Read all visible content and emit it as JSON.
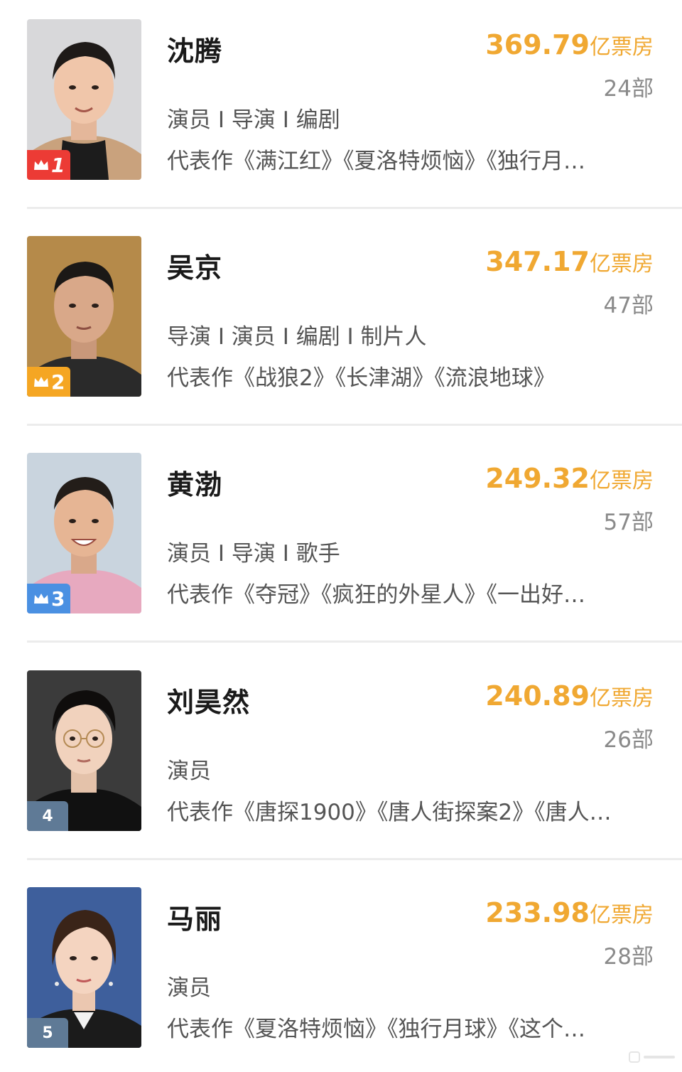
{
  "ranking": [
    {
      "rank": "1",
      "name": "沈腾",
      "box_office": "369.79",
      "box_office_unit": "亿票房",
      "film_count": "24部",
      "roles": "演员 I 导演 I 编剧",
      "works": "代表作《满江红》《夏洛特烦恼》《独行月…",
      "badge_color": "#ec3b35",
      "photo_bg": "#d8d8da",
      "shirt_color": "#1c1c1c",
      "coat_color": "#c9a27d"
    },
    {
      "rank": "2",
      "name": "吴京",
      "box_office": "347.17",
      "box_office_unit": "亿票房",
      "film_count": "47部",
      "roles": "导演 I 演员 I 编剧 I 制片人",
      "works": "代表作《战狼2》《长津湖》《流浪地球》",
      "badge_color": "#f5a623",
      "photo_bg": "#b58a4a",
      "shirt_color": "#2a2a2a",
      "coat_color": "#2a2a2a"
    },
    {
      "rank": "3",
      "name": "黄渤",
      "box_office": "249.32",
      "box_office_unit": "亿票房",
      "film_count": "57部",
      "roles": "演员 I 导演 I 歌手",
      "works": "代表作《夺冠》《疯狂的外星人》《一出好…",
      "badge_color": "#4a90e2",
      "photo_bg": "#c9d4de",
      "shirt_color": "#e7a9bf",
      "coat_color": "#e7a9bf"
    },
    {
      "rank": "4",
      "name": "刘昊然",
      "box_office": "240.89",
      "box_office_unit": "亿票房",
      "film_count": "26部",
      "roles": "演员",
      "works": "代表作《唐探1900》《唐人街探案2》《唐人…",
      "badge_color": "#5f7a96",
      "photo_bg": "#3b3b3b",
      "shirt_color": "#111111",
      "coat_color": "#111111"
    },
    {
      "rank": "5",
      "name": "马丽",
      "box_office": "233.98",
      "box_office_unit": "亿票房",
      "film_count": "28部",
      "roles": "演员",
      "works": "代表作《夏洛特烦恼》《独行月球》《这个…",
      "badge_color": "#5f7a96",
      "photo_bg": "#3e5f9c",
      "shirt_color": "#1b1b1b",
      "coat_color": "#1b1b1b"
    }
  ]
}
